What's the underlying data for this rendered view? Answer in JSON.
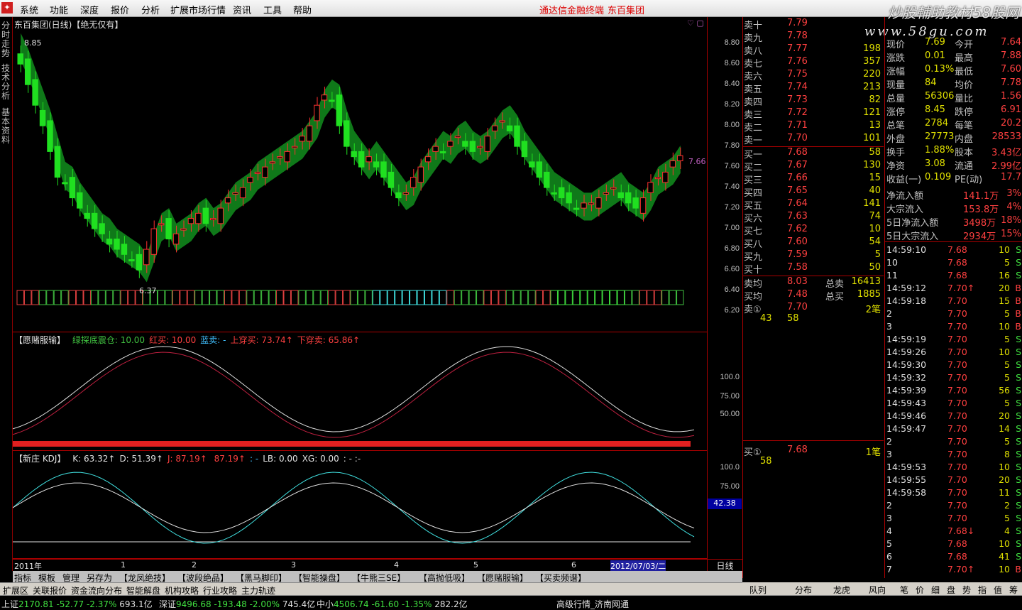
{
  "menu": {
    "items": [
      "系统",
      "功能",
      "深度",
      "报价",
      "分析",
      "扩展市场行情",
      "资讯",
      "工具",
      "帮助"
    ],
    "broker": "通达信金融终端",
    "stock_name": "东百集团",
    "watermark": "炒股輔助教材58股网",
    "watermark2": "www.58gu.com"
  },
  "lefttabs": [
    "分时走势",
    "技术分析",
    "基本资料"
  ],
  "chart": {
    "title": "东百集团(日线)【绝无仅有】",
    "high_label": "8.85",
    "low_label": "6.37",
    "last_label": "7.66",
    "price_ticks": [
      "8.80",
      "8.60",
      "8.40",
      "8.20",
      "8.00",
      "7.80",
      "7.60",
      "7.40",
      "7.20",
      "7.00",
      "6.80",
      "6.60",
      "6.40",
      "6.20"
    ]
  },
  "chart_data": {
    "type": "candlestick",
    "ylim": [
      6.2,
      8.85
    ],
    "date_labels": [
      "2011年",
      "1",
      "2",
      "3",
      "4",
      "5",
      "6",
      "2012/07/03/二"
    ]
  },
  "ind1": {
    "name": "【愿赌服输】",
    "items": [
      {
        "label": "绿探底震仓:",
        "value": "10.00",
        "color": "#40c040"
      },
      {
        "label": "红买:",
        "value": "10.00",
        "color": "#ff4040"
      },
      {
        "label": "蓝卖:",
        "value": "-",
        "color": "#40c0ff"
      },
      {
        "label": "上穿买:",
        "value": "73.74↑",
        "color": "#ff4040"
      },
      {
        "label": "下穿卖:",
        "value": "65.86↑",
        "color": "#ff4040"
      }
    ],
    "ticks": [
      "100.0",
      "75.00",
      "50.00"
    ]
  },
  "ind2": {
    "name": "【新庄 KDJ】",
    "items": [
      {
        "label": "K:",
        "value": "63.32↑",
        "color": "#e0e0e0"
      },
      {
        "label": "D:",
        "value": "51.39↑",
        "color": "#e0e0e0"
      },
      {
        "label": "J:",
        "value": "87.19↑",
        "color": "#ff4040"
      },
      {
        "label": "",
        "value": "87.19↑",
        "color": "#ff4040"
      },
      {
        "label": ":",
        "value": "-",
        "color": "#40c0ff"
      },
      {
        "label": "LB:",
        "value": "0.00",
        "color": "#e0e0e0"
      },
      {
        "label": "XG:",
        "value": "0.00",
        "color": "#e0e0e0"
      },
      {
        "label": ":",
        "value": "-  :-",
        "color": "#e0e0e0"
      }
    ],
    "ticks": [
      "100.0",
      "75.00"
    ],
    "cursor_val": "42.38"
  },
  "period_label": "日线",
  "asks": [
    {
      "l": "卖十",
      "p": "7.79",
      "v": ""
    },
    {
      "l": "卖九",
      "p": "7.78",
      "v": ""
    },
    {
      "l": "卖八",
      "p": "7.77",
      "v": "198"
    },
    {
      "l": "卖七",
      "p": "7.76",
      "v": "357"
    },
    {
      "l": "卖六",
      "p": "7.75",
      "v": "220"
    },
    {
      "l": "卖五",
      "p": "7.74",
      "v": "213"
    },
    {
      "l": "卖四",
      "p": "7.73",
      "v": "82"
    },
    {
      "l": "卖三",
      "p": "7.72",
      "v": "121"
    },
    {
      "l": "卖二",
      "p": "7.71",
      "v": "13"
    },
    {
      "l": "卖一",
      "p": "7.70",
      "v": "101"
    }
  ],
  "bids": [
    {
      "l": "买一",
      "p": "7.68",
      "v": "58"
    },
    {
      "l": "买二",
      "p": "7.67",
      "v": "130"
    },
    {
      "l": "买三",
      "p": "7.66",
      "v": "15"
    },
    {
      "l": "买四",
      "p": "7.65",
      "v": "40"
    },
    {
      "l": "买五",
      "p": "7.64",
      "v": "141"
    },
    {
      "l": "买六",
      "p": "7.63",
      "v": "74"
    },
    {
      "l": "买七",
      "p": "7.62",
      "v": "10"
    },
    {
      "l": "买八",
      "p": "7.60",
      "v": "54"
    },
    {
      "l": "买九",
      "p": "7.59",
      "v": "5"
    },
    {
      "l": "买十",
      "p": "7.58",
      "v": "50"
    }
  ],
  "avg": [
    {
      "l": "卖均",
      "p": "8.03",
      "t": "总卖",
      "v": "16413"
    },
    {
      "l": "买均",
      "p": "7.48",
      "t": "总买",
      "v": "1885"
    }
  ],
  "sell1": {
    "l": "卖①",
    "p": "7.70",
    "v": "2笔",
    "a": "43",
    "b": "58"
  },
  "buy1": {
    "l": "买①",
    "p": "7.68",
    "v": "1笔",
    "a": "58"
  },
  "stats": [
    {
      "a": "现价",
      "b": "7.69",
      "c": "今开",
      "d": "7.64"
    },
    {
      "a": "涨跌",
      "b": "0.01",
      "c": "最高",
      "d": "7.88"
    },
    {
      "a": "涨幅",
      "b": "0.13%",
      "c": "最低",
      "d": "7.60"
    },
    {
      "a": "现量",
      "b": "84",
      "c": "均价",
      "d": "7.78"
    },
    {
      "a": "总量",
      "b": "56306",
      "c": "量比",
      "d": "1.56"
    },
    {
      "a": "涨停",
      "b": "8.45",
      "c": "跌停",
      "d": "6.91"
    },
    {
      "a": "总笔",
      "b": "2784",
      "c": "每笔",
      "d": "20.2"
    },
    {
      "a": "外盘",
      "b": "27773",
      "c": "内盘",
      "d": "28533"
    },
    {
      "a": "换手",
      "b": "1.88%",
      "c": "股本",
      "d": "3.43亿"
    },
    {
      "a": "净资",
      "b": "3.08",
      "c": "流通",
      "d": "2.99亿"
    },
    {
      "a": "收益(一)",
      "b": "0.109",
      "c": "PE(动)",
      "d": "17.7"
    }
  ],
  "flows": [
    {
      "a": "净流入额",
      "b": "141.1万",
      "d": "3%"
    },
    {
      "a": "大宗流入",
      "b": "153.8万",
      "d": "4%"
    },
    {
      "a": "5日净流入额",
      "b": "3498万",
      "d": "18%"
    },
    {
      "a": "5日大宗流入",
      "b": "2934万",
      "d": "15%"
    }
  ],
  "ticks": [
    {
      "t": "14:59:10",
      "p": "7.68",
      "v": "10",
      "s": "S"
    },
    {
      "t": "10",
      "p": "7.68",
      "v": "5",
      "s": "S"
    },
    {
      "t": "11",
      "p": "7.68",
      "v": "16",
      "s": "S"
    },
    {
      "t": "14:59:12",
      "p": "7.70↑",
      "v": "20",
      "s": "B"
    },
    {
      "t": "14:59:18",
      "p": "7.70",
      "v": "15",
      "s": "B"
    },
    {
      "t": "2",
      "p": "7.70",
      "v": "5",
      "s": "B"
    },
    {
      "t": "3",
      "p": "7.70",
      "v": "10",
      "s": "B"
    },
    {
      "t": "14:59:19",
      "p": "7.70",
      "v": "5",
      "s": "S"
    },
    {
      "t": "14:59:26",
      "p": "7.70",
      "v": "10",
      "s": "S"
    },
    {
      "t": "14:59:30",
      "p": "7.70",
      "v": "5",
      "s": "S"
    },
    {
      "t": "14:59:32",
      "p": "7.70",
      "v": "5",
      "s": "S"
    },
    {
      "t": "14:59:39",
      "p": "7.70",
      "v": "56",
      "s": "S"
    },
    {
      "t": "14:59:43",
      "p": "7.70",
      "v": "5",
      "s": "S"
    },
    {
      "t": "14:59:46",
      "p": "7.70",
      "v": "20",
      "s": "S"
    },
    {
      "t": "14:59:47",
      "p": "7.70",
      "v": "14",
      "s": "S"
    },
    {
      "t": "2",
      "p": "7.70",
      "v": "5",
      "s": "S"
    },
    {
      "t": "3",
      "p": "7.70",
      "v": "8",
      "s": "S"
    },
    {
      "t": "14:59:53",
      "p": "7.70",
      "v": "10",
      "s": "S"
    },
    {
      "t": "14:59:55",
      "p": "7.70",
      "v": "20",
      "s": "S"
    },
    {
      "t": "14:59:58",
      "p": "7.70",
      "v": "11",
      "s": "S"
    },
    {
      "t": "2",
      "p": "7.70",
      "v": "2",
      "s": "S"
    },
    {
      "t": "3",
      "p": "7.70",
      "v": "5",
      "s": "S"
    },
    {
      "t": "4",
      "p": "7.68↓",
      "v": "4",
      "s": "S"
    },
    {
      "t": "5",
      "p": "7.68",
      "v": "10",
      "s": "S"
    },
    {
      "t": "6",
      "p": "7.68",
      "v": "41",
      "s": "S"
    },
    {
      "t": "7",
      "p": "7.70↑",
      "v": "10",
      "s": "B"
    }
  ],
  "bottomtabs": [
    "指标",
    "模板",
    "管理",
    "另存为",
    "【龙凤绝技】",
    "【波段绝品】",
    "【黑马脚印】",
    "【智能操盘】",
    "【牛熊三SE】",
    "【高抛低吸】",
    "【愿赌服输】",
    "【买卖频谱】"
  ],
  "bottom2": [
    "扩展区",
    "关联报价",
    "资金流向分布",
    "智能解盘",
    "机构攻略",
    "行业攻略",
    "主力轨迹"
  ],
  "qtabs": [
    "队列",
    "分布",
    "龙虎",
    "风向",
    "笔",
    "价",
    "细",
    "盘",
    "势",
    "指",
    "值",
    "筹"
  ],
  "status": [
    {
      "name": "上证",
      "val": "2170.81",
      "chg": "-52.77",
      "pct": "-2.37%",
      "amt": "693.1亿"
    },
    {
      "name": "深证",
      "val": "9496.68",
      "chg": "-193.48",
      "pct": "-2.00%",
      "amt": "745.4亿"
    },
    {
      "name": "中小",
      "val": "4506.74",
      "chg": "-61.60",
      "pct": "-1.35%",
      "amt": "282.2亿"
    }
  ],
  "status_right": "高级行情_济南网通"
}
